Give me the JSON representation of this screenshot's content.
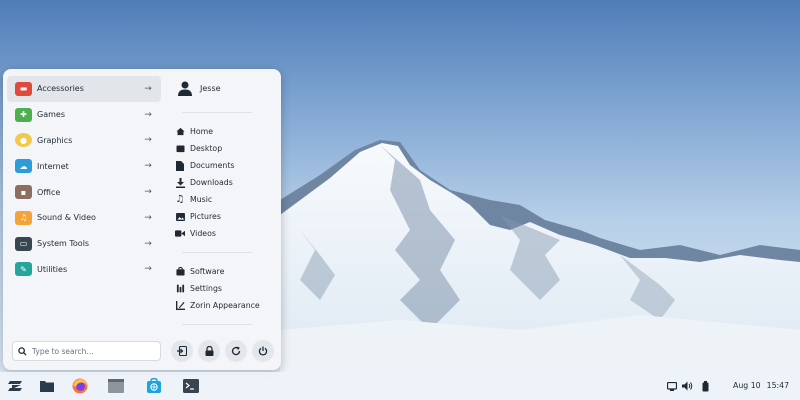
{
  "menu": {
    "categories": [
      {
        "label": "Accessories",
        "icon": "toolbox-icon",
        "color": "#e04a3c"
      },
      {
        "label": "Games",
        "icon": "gamepad-icon",
        "color": "#4caf50"
      },
      {
        "label": "Graphics",
        "icon": "palette-icon",
        "color": "#f2c94c"
      },
      {
        "label": "Internet",
        "icon": "cloud-icon",
        "color": "#2d9cdb"
      },
      {
        "label": "Office",
        "icon": "briefcase-icon",
        "color": "#8d6e63"
      },
      {
        "label": "Sound & Video",
        "icon": "media-icon",
        "color": "#f2a33a"
      },
      {
        "label": "System Tools",
        "icon": "monitor-icon",
        "color": "#37474f"
      },
      {
        "label": "Utilities",
        "icon": "utilities-icon",
        "color": "#26a69a"
      }
    ],
    "search_placeholder": "Type to search...",
    "user": {
      "name": "Jesse"
    },
    "places": [
      {
        "label": "Home",
        "icon": "home-icon"
      },
      {
        "label": "Desktop",
        "icon": "desktop-icon"
      },
      {
        "label": "Documents",
        "icon": "documents-icon"
      },
      {
        "label": "Downloads",
        "icon": "downloads-icon"
      },
      {
        "label": "Music",
        "icon": "music-icon"
      },
      {
        "label": "Pictures",
        "icon": "pictures-icon"
      },
      {
        "label": "Videos",
        "icon": "videos-icon"
      }
    ],
    "system": [
      {
        "label": "Software",
        "icon": "software-icon"
      },
      {
        "label": "Settings",
        "icon": "settings-icon"
      },
      {
        "label": "Zorin Appearance",
        "icon": "appearance-icon"
      }
    ],
    "session_buttons": [
      "logout-icon",
      "lock-icon",
      "restart-icon",
      "power-icon"
    ]
  },
  "taskbar": {
    "apps": [
      "zorin-menu-icon",
      "files-icon",
      "firefox-icon",
      "file-manager-icon",
      "software-store-icon",
      "terminal-icon"
    ],
    "tray": [
      "display-icon",
      "volume-icon",
      "battery-icon"
    ],
    "date": "Aug 10",
    "time": "15:47"
  }
}
